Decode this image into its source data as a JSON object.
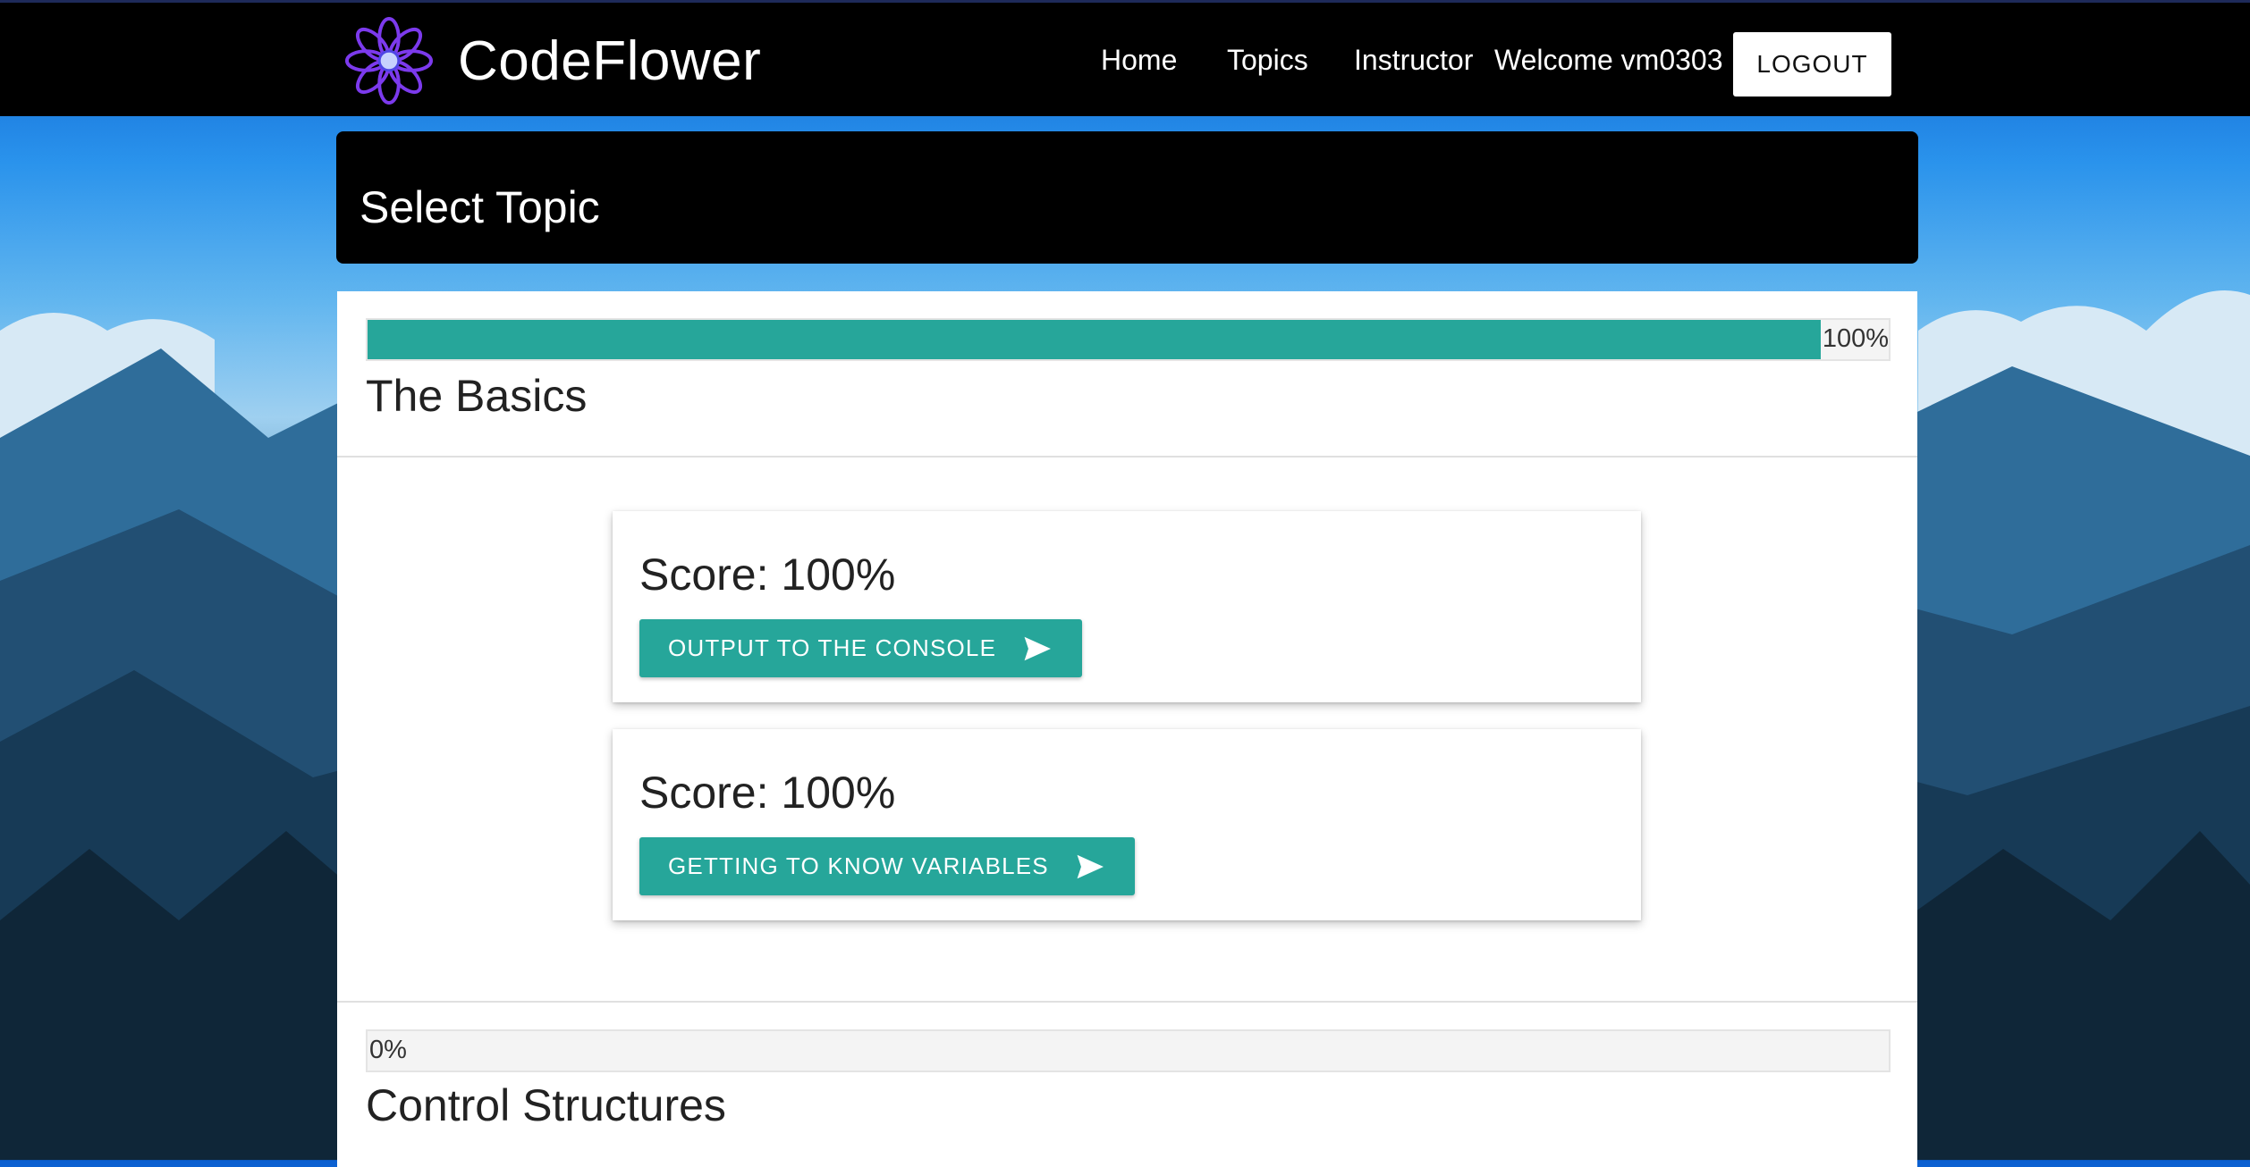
{
  "brand": {
    "name": "CodeFlower",
    "logo_icon": "flower-icon"
  },
  "nav": {
    "links": [
      "Home",
      "Topics",
      "Instructor"
    ],
    "welcome": "Welcome vm0303",
    "logout_label": "LOGOUT"
  },
  "header": {
    "title": "Select Topic"
  },
  "topics": [
    {
      "title": "The Basics",
      "progress": 100,
      "progress_label": "100%",
      "lessons": [
        {
          "score": "Score: 100%",
          "button_label": "OUTPUT TO THE CONSOLE",
          "icon": "send-icon"
        },
        {
          "score": "Score: 100%",
          "button_label": "GETTING TO KNOW VARIABLES",
          "icon": "send-icon"
        }
      ]
    },
    {
      "title": "Control Structures",
      "progress": 0,
      "progress_label": "0%"
    }
  ],
  "colors": {
    "accent": "#26a69a",
    "navbar": "#000000",
    "logo": "#7c3aed"
  }
}
